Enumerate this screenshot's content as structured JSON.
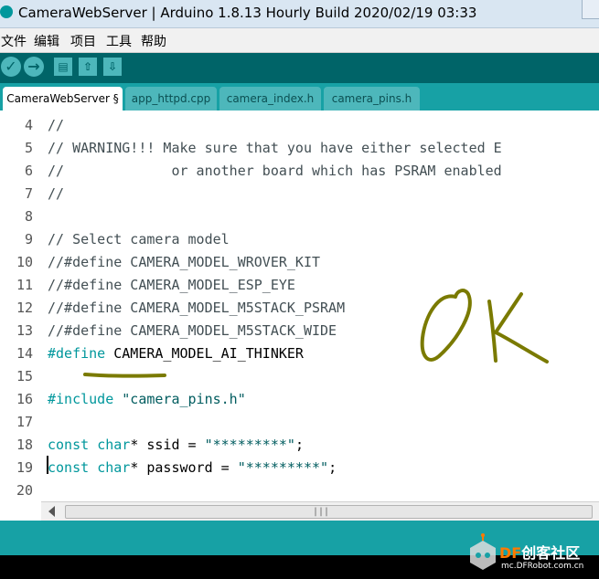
{
  "window": {
    "title": "CameraWebServer | Arduino 1.8.13 Hourly Build 2020/02/19 03:33"
  },
  "menu": {
    "items": [
      "文件",
      "编辑",
      "项目",
      "工具",
      "帮助"
    ]
  },
  "toolbar": {
    "verify_glyph": "✓",
    "upload_glyph": "→",
    "new_glyph": "▤",
    "open_glyph": "⇧",
    "save_glyph": "⇩"
  },
  "tabs": [
    {
      "label": "CameraWebServer §",
      "active": true
    },
    {
      "label": "app_httpd.cpp",
      "active": false
    },
    {
      "label": "camera_index.h",
      "active": false
    },
    {
      "label": "camera_pins.h",
      "active": false
    }
  ],
  "editor": {
    "lines": [
      {
        "num": "4",
        "tokens": [
          {
            "t": "//",
            "c": "comment"
          }
        ]
      },
      {
        "num": "5",
        "tokens": [
          {
            "t": "// WARNING!!! Make sure that you have either selected E",
            "c": "comment"
          }
        ]
      },
      {
        "num": "6",
        "tokens": [
          {
            "t": "//             or another board which has PSRAM enabled",
            "c": "comment"
          }
        ]
      },
      {
        "num": "7",
        "tokens": [
          {
            "t": "//",
            "c": "comment"
          }
        ]
      },
      {
        "num": "8",
        "tokens": []
      },
      {
        "num": "9",
        "tokens": [
          {
            "t": "// Select camera model",
            "c": "comment"
          }
        ]
      },
      {
        "num": "10",
        "tokens": [
          {
            "t": "//#define CAMERA_MODEL_WROVER_KIT",
            "c": "comment"
          }
        ]
      },
      {
        "num": "11",
        "tokens": [
          {
            "t": "//#define CAMERA_MODEL_ESP_EYE",
            "c": "comment"
          }
        ]
      },
      {
        "num": "12",
        "tokens": [
          {
            "t": "//#define CAMERA_MODEL_M5STACK_PSRAM",
            "c": "comment"
          }
        ]
      },
      {
        "num": "13",
        "tokens": [
          {
            "t": "//#define CAMERA_MODEL_M5STACK_WIDE",
            "c": "comment"
          }
        ]
      },
      {
        "num": "14",
        "tokens": [
          {
            "t": "#define",
            "c": "kw"
          },
          {
            "t": " CAMERA_MODEL_AI_THINKER",
            "c": "plain"
          }
        ]
      },
      {
        "num": "15",
        "tokens": []
      },
      {
        "num": "16",
        "tokens": [
          {
            "t": "#include",
            "c": "kw"
          },
          {
            "t": " ",
            "c": "plain"
          },
          {
            "t": "\"camera_pins.h\"",
            "c": "str"
          }
        ]
      },
      {
        "num": "17",
        "tokens": []
      },
      {
        "num": "18",
        "tokens": [
          {
            "t": "const",
            "c": "kw"
          },
          {
            "t": " ",
            "c": "plain"
          },
          {
            "t": "char",
            "c": "kw"
          },
          {
            "t": "* ssid = ",
            "c": "plain"
          },
          {
            "t": "\"*********\"",
            "c": "str"
          },
          {
            "t": ";",
            "c": "plain"
          }
        ]
      },
      {
        "num": "19",
        "tokens": [
          {
            "t": "const",
            "c": "kw"
          },
          {
            "t": " ",
            "c": "plain"
          },
          {
            "t": "char",
            "c": "kw"
          },
          {
            "t": "* password = ",
            "c": "plain"
          },
          {
            "t": "\"*********\"",
            "c": "str"
          },
          {
            "t": ";",
            "c": "plain"
          }
        ]
      },
      {
        "num": "20",
        "tokens": []
      }
    ]
  },
  "scrollbar": {
    "grip": "|||"
  },
  "annotation": {
    "handwritten_text": "OK",
    "color": "#7a7a00"
  },
  "watermark": {
    "brand_df": "DF",
    "brand_cn": "创客社区",
    "url": "mc.DFRobot.com.cn"
  },
  "colors": {
    "accent_dark": "#006468",
    "accent": "#17a1a5",
    "keyword": "#00979c",
    "comment": "#434f54"
  }
}
